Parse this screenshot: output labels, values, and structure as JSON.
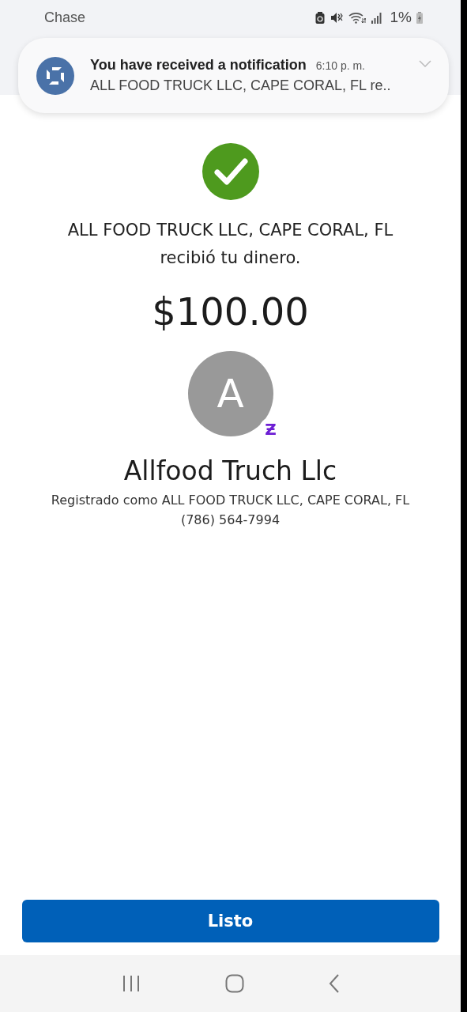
{
  "status_bar": {
    "app_name": "Chase",
    "battery": "1%"
  },
  "notification": {
    "title": "You have received a notification",
    "time": "6:10 p. m.",
    "body": "ALL FOOD TRUCK LLC, CAPE CORAL, FL re.."
  },
  "confirmation": {
    "message": "ALL FOOD TRUCK LLC, CAPE CORAL, FL recibió tu dinero.",
    "amount": "$100.00"
  },
  "recipient": {
    "initial": "A",
    "badge": "Ƶ",
    "name": "Allfood Truch Llc",
    "registered_as": "Registrado como ALL FOOD TRUCK LLC, CAPE CORAL, FL",
    "phone": "(786) 564-7994"
  },
  "done_button": {
    "label": "Listo"
  }
}
